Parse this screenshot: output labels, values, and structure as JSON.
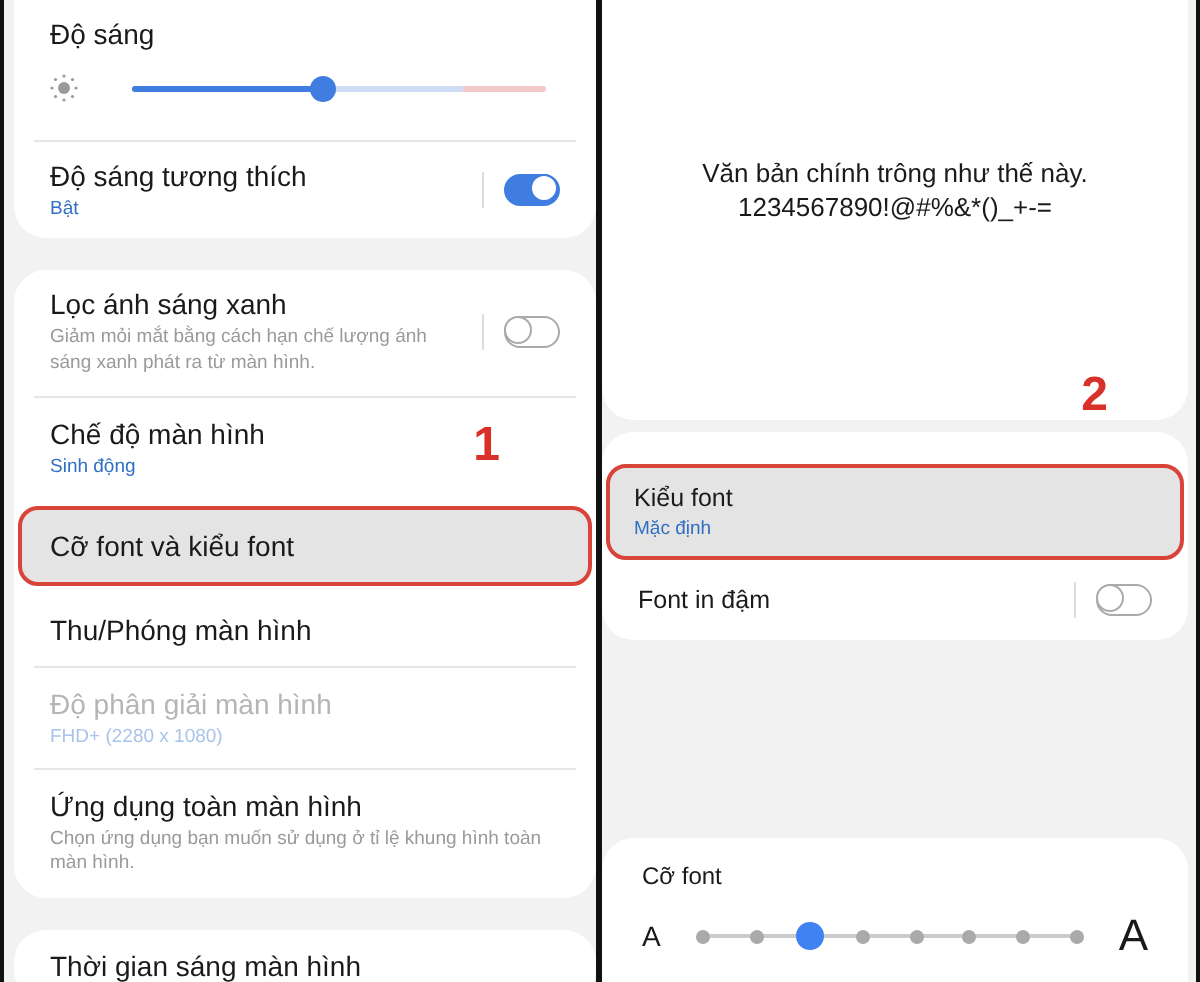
{
  "left_panel": {
    "sections": [
      {
        "items": [
          {
            "kind": "slider",
            "title": "Độ sáng",
            "level": 0.46
          },
          {
            "kind": "toggle",
            "title": "Độ sáng tương thích",
            "subtitle": "Bật",
            "on": true
          }
        ]
      },
      {
        "items": [
          {
            "kind": "toggle",
            "title": "Lọc ánh sáng xanh",
            "description": "Giảm mỏi mắt bằng cách hạn chế lượng ánh sáng xanh phát ra từ màn hình.",
            "on": false
          },
          {
            "kind": "row",
            "title": "Chế độ màn hình",
            "subtitle": "Sinh động",
            "disabled": false,
            "highlighted": false
          },
          {
            "kind": "row",
            "title": "Cỡ font và kiểu font",
            "disabled": false,
            "highlighted": true,
            "annotation": "1"
          },
          {
            "kind": "row",
            "title": "Thu/Phóng màn hình",
            "disabled": false,
            "highlighted": false
          },
          {
            "kind": "row",
            "title": "Độ phân giải màn hình",
            "subtitle": "FHD+ (2280 x 1080)",
            "disabled": true,
            "highlighted": false
          },
          {
            "kind": "row",
            "title": "Ứng dụng toàn màn hình",
            "description": "Chọn ứng dụng bạn muốn sử dụng ở tỉ lệ khung hình toàn màn hình.",
            "disabled": false,
            "highlighted": false
          }
        ]
      },
      {
        "items": [
          {
            "kind": "row",
            "title": "Thời gian sáng màn hình",
            "disabled": false,
            "highlighted": false
          }
        ]
      }
    ]
  },
  "right_panel": {
    "preview": [
      "Văn bản chính trông như thế này.",
      "1234567890!@#%&*()_+-="
    ],
    "items": [
      {
        "kind": "row",
        "title": "Kiểu font",
        "subtitle": "Mặc định",
        "disabled": false,
        "highlighted": true,
        "annotation": "2"
      },
      {
        "kind": "toggle",
        "title": "Font in đậm",
        "on": false
      }
    ],
    "font_size": {
      "title": "Cỡ font",
      "small_label": "A",
      "large_label": "A",
      "level": 0.2857
    }
  }
}
